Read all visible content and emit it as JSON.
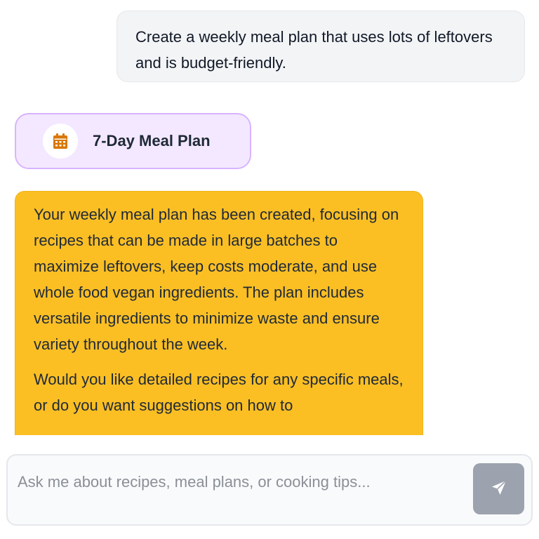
{
  "conversation": {
    "user_message": "Create a weekly meal plan that uses lots of leftovers and is budget-friendly.",
    "plan_card": {
      "icon": "calendar-icon",
      "title": "7-Day Meal Plan"
    },
    "assistant_message": {
      "paragraph_1": "Your weekly meal plan has been created, focusing on recipes that can be made in large batches to maximize leftovers, keep costs moderate, and use whole food vegan ingredients. The plan includes versatile ingredients to minimize waste and ensure variety throughout the week.",
      "paragraph_2": "Would you like detailed recipes for any specific meals, or do you want suggestions on how to"
    }
  },
  "composer": {
    "placeholder": "Ask me about recipes, meal plans, or cooking tips...",
    "value": "",
    "send_icon": "send-icon"
  },
  "colors": {
    "assistant_bubble": "#fbbf24",
    "plan_card_bg": "#f3e8ff",
    "plan_card_border": "#d8b4fe",
    "icon_accent": "#d97706",
    "send_button": "#9ca3af"
  }
}
